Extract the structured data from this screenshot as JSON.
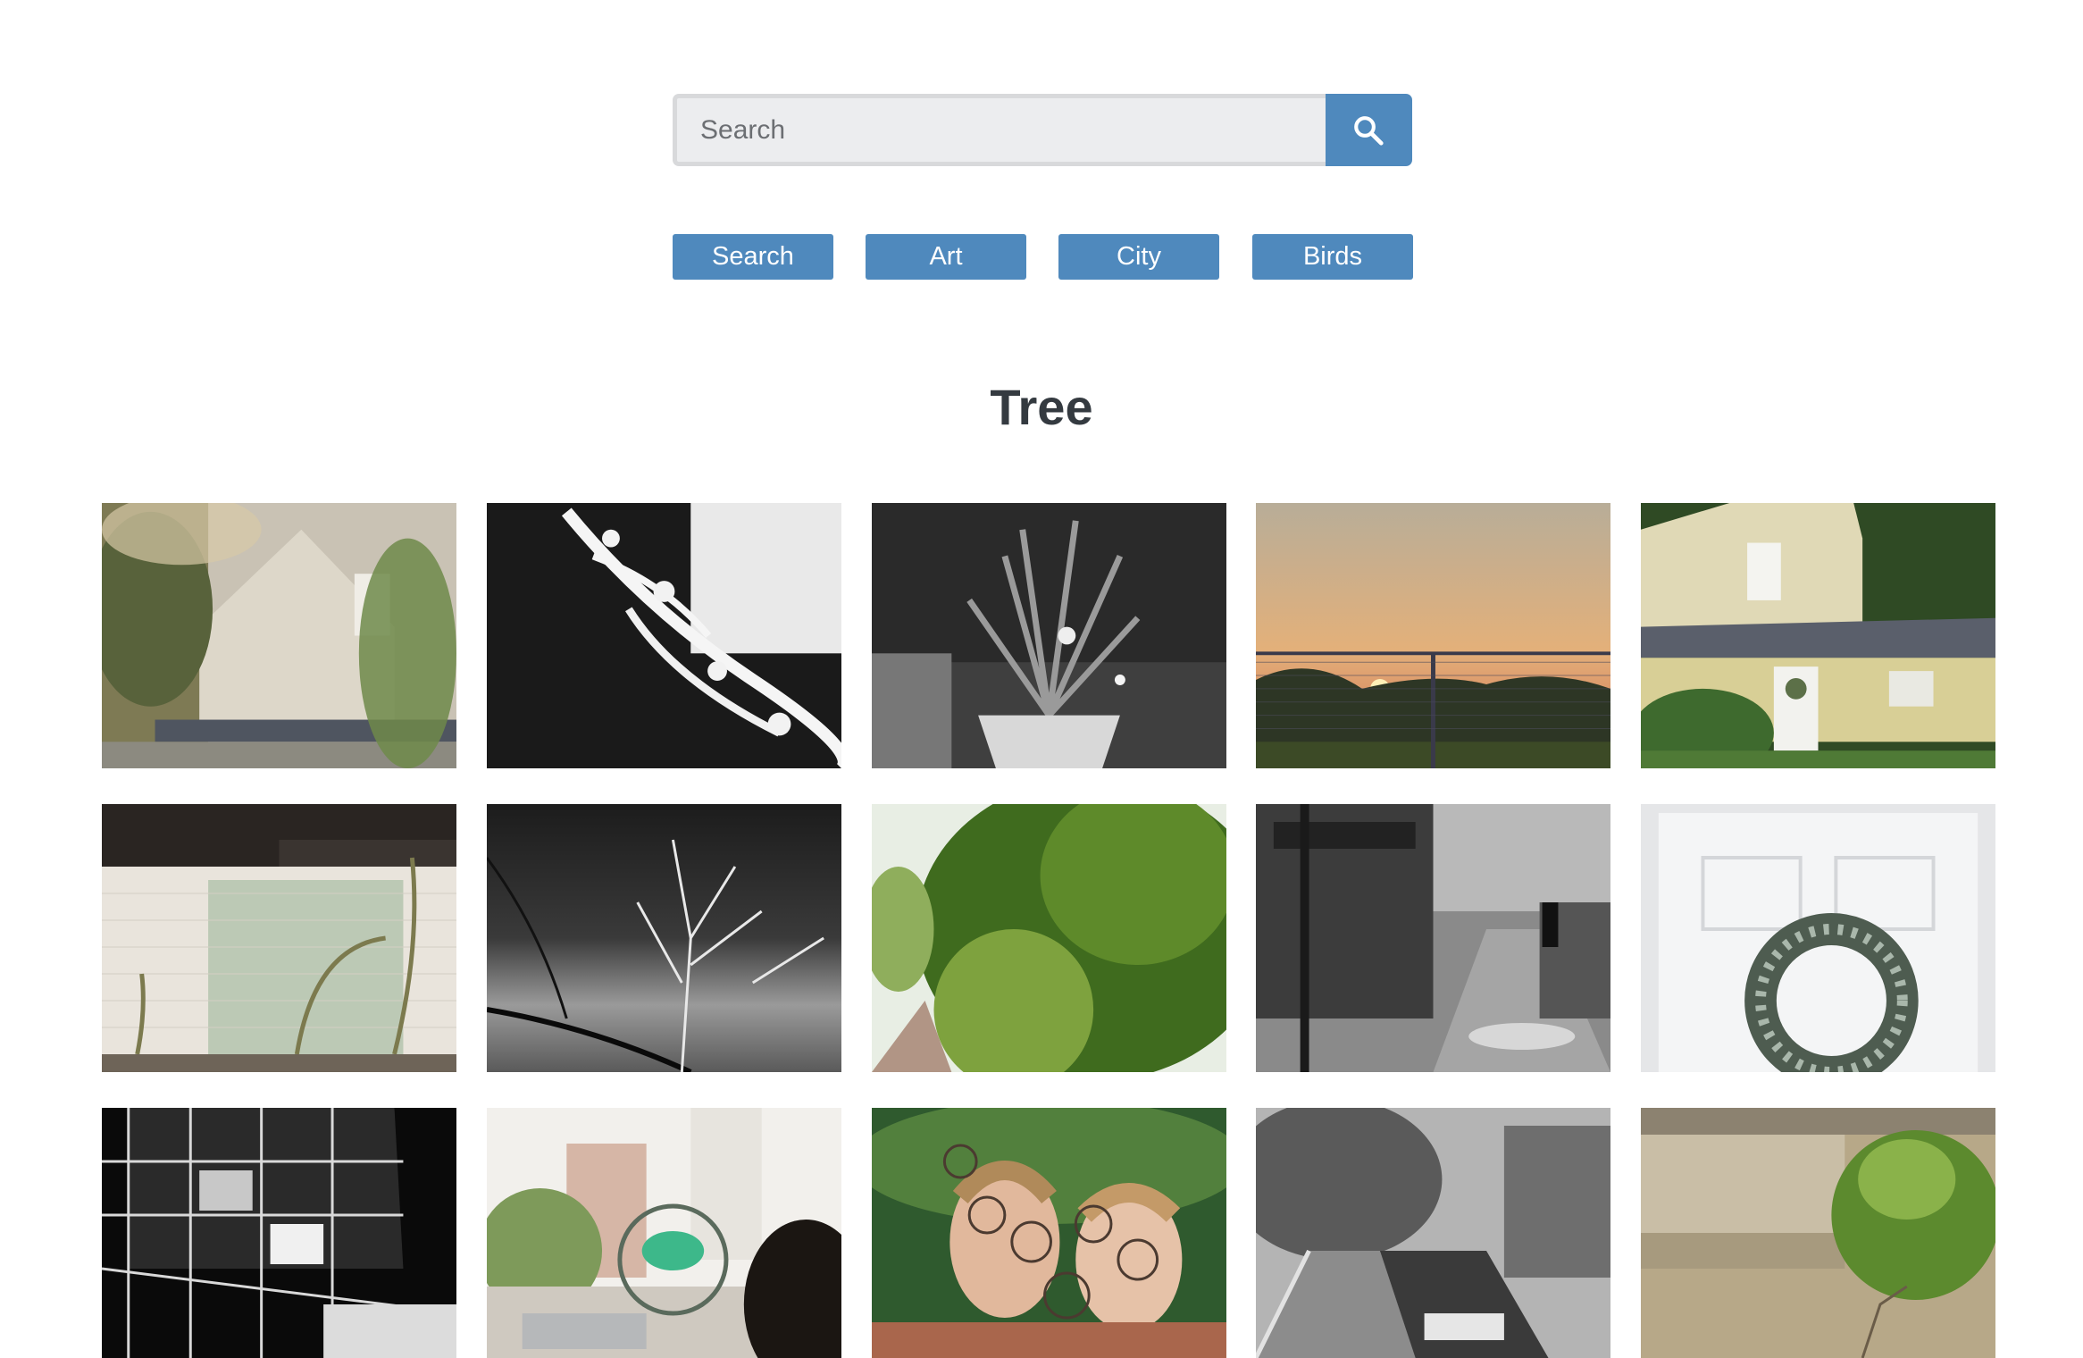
{
  "search": {
    "placeholder": "Search",
    "value": ""
  },
  "tags": [
    "Search",
    "Art",
    "City",
    "Birds"
  ],
  "page_title": "Tree",
  "colors": {
    "accent": "#4f89bd",
    "input_background": "#ecedef",
    "heading": "#343a40"
  },
  "photos": [
    {
      "subject": "white house with leafy branches"
    },
    {
      "subject": "black and white inverted branches"
    },
    {
      "subject": "black and white potted palm plant"
    },
    {
      "subject": "sunset behind chain-link fence"
    },
    {
      "subject": "cream house with wreath on door"
    },
    {
      "subject": "vines climbing white brick wall"
    },
    {
      "subject": "black and white bare branches"
    },
    {
      "subject": "green hedge along sidewalk"
    },
    {
      "subject": "black and white alley with walker"
    },
    {
      "subject": "wreath on white door"
    },
    {
      "subject": "black and white glass building"
    },
    {
      "subject": "city street with dinosaur window sign"
    },
    {
      "subject": "two girls behind decorative metalwork"
    },
    {
      "subject": "black and white walkway by canal"
    },
    {
      "subject": "plant growing beside concrete step"
    }
  ]
}
